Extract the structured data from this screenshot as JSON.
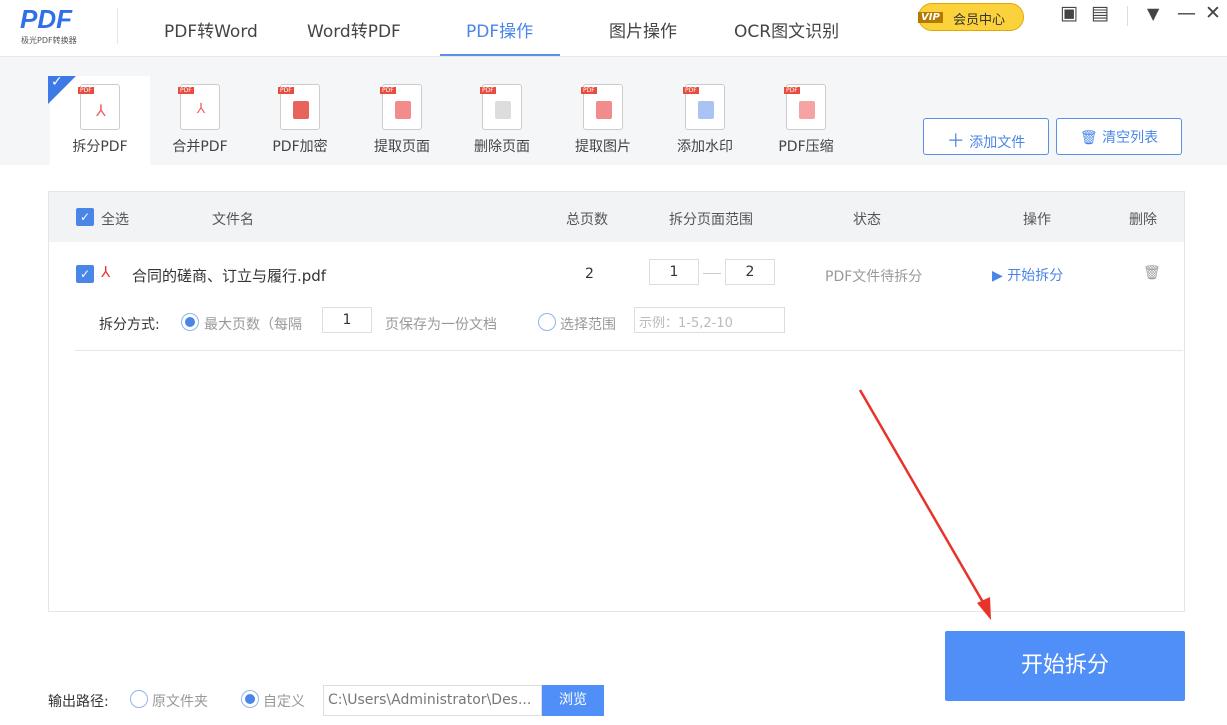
{
  "app": {
    "logo": "PDF",
    "logo_sub": "极光PDF转换器"
  },
  "nav": [
    "PDF转Word",
    "Word转PDF",
    "PDF操作",
    "图片操作",
    "OCR图文识别"
  ],
  "vip": {
    "badge": "VIP",
    "label": "会员中心"
  },
  "tools": [
    "拆分PDF",
    "合并PDF",
    "PDF加密",
    "提取页面",
    "删除页面",
    "提取图片",
    "添加水印",
    "PDF压缩"
  ],
  "actions": {
    "add": "添加文件",
    "clear": "清空列表"
  },
  "table": {
    "headers": {
      "select_all": "全选",
      "name": "文件名",
      "pages": "总页数",
      "range": "拆分页面范围",
      "status": "状态",
      "op": "操作",
      "del": "删除"
    },
    "rows": [
      {
        "name": "合同的磋商、订立与履行.pdf",
        "pages": "2",
        "from": "1",
        "to": "2",
        "status": "PDF文件待拆分",
        "op": "开始拆分",
        "mode_label": "拆分方式:",
        "mode1": "最大页数（每隔",
        "every": "1",
        "mode1_suffix": "页保存为一份文档",
        "mode2": "选择范围",
        "range_placeholder": "示例：1-5,2-10"
      }
    ]
  },
  "output": {
    "label": "输出路径:",
    "opt1": "原文件夹",
    "opt2": "自定义",
    "path": "C:\\Users\\Administrator\\Des...",
    "browse": "浏览"
  },
  "start": "开始拆分",
  "colors": {
    "accent": "#4a86e8",
    "arrow": "#e8322a"
  }
}
